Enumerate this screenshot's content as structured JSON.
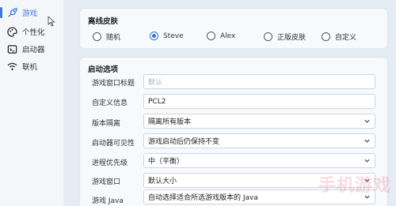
{
  "sidebar": {
    "items": [
      {
        "label": "游戏",
        "icon": "rocket-icon",
        "active": true
      },
      {
        "label": "个性化",
        "icon": "palette-icon",
        "active": false
      },
      {
        "label": "启动器",
        "icon": "launcher-icon",
        "active": false
      },
      {
        "label": "联机",
        "icon": "wifi-icon",
        "active": false
      }
    ]
  },
  "skin": {
    "title": "离线皮肤",
    "options": [
      "随机",
      "Steve",
      "Alex",
      "正版皮肤",
      "自定义"
    ],
    "selected": "Steve"
  },
  "launch": {
    "title": "启动选项",
    "rows": [
      {
        "label": "游戏窗口标题",
        "value": "默认",
        "placeholder": true,
        "dropdown": false
      },
      {
        "label": "自定义信息",
        "value": "PCL2",
        "placeholder": false,
        "dropdown": false
      },
      {
        "label": "版本隔离",
        "value": "隔离所有版本",
        "placeholder": false,
        "dropdown": true
      },
      {
        "label": "启动器可见性",
        "value": "游戏启动后仍保持不变",
        "placeholder": false,
        "dropdown": true
      },
      {
        "label": "进程优先级",
        "value": "中（平衡）",
        "placeholder": false,
        "dropdown": true
      },
      {
        "label": "游戏窗口",
        "value": "默认大小",
        "placeholder": false,
        "dropdown": true
      },
      {
        "label": "游戏 Java",
        "value": "自动选择适合所选游戏版本的 Java",
        "placeholder": false,
        "dropdown": true
      }
    ]
  },
  "colors": {
    "accent": "#3a7be0",
    "background": "#e6ecf4",
    "card": "#f7f9fc"
  },
  "watermark": "手机游戏"
}
